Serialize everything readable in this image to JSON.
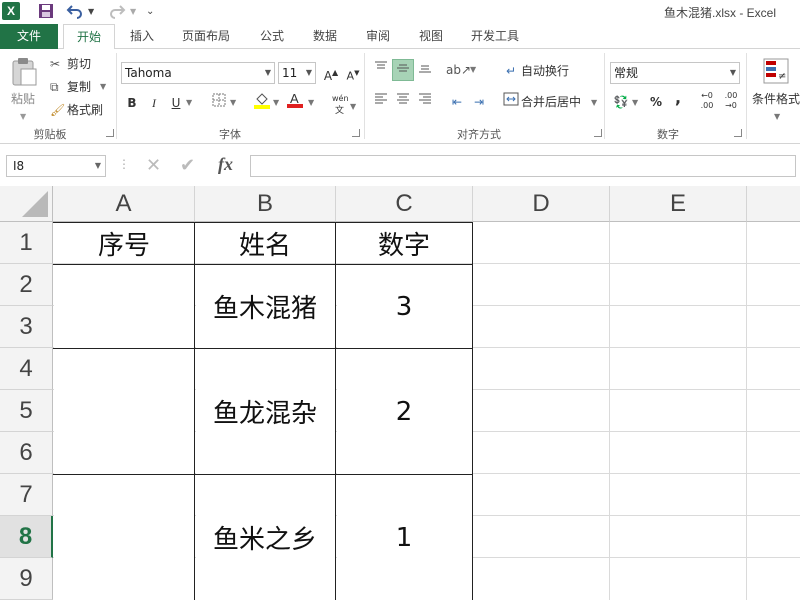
{
  "window": {
    "title": "鱼木混猪.xlsx - Excel",
    "app_logo": "X"
  },
  "quick_access": {
    "save_icon": "save-icon",
    "undo_icon": "undo-icon",
    "redo_icon": "redo-icon"
  },
  "tabs": [
    {
      "label": "文件"
    },
    {
      "label": "开始"
    },
    {
      "label": "插入"
    },
    {
      "label": "页面布局"
    },
    {
      "label": "公式"
    },
    {
      "label": "数据"
    },
    {
      "label": "审阅"
    },
    {
      "label": "视图"
    },
    {
      "label": "开发工具"
    }
  ],
  "ribbon": {
    "clipboard": {
      "paste": "粘贴",
      "cut": "剪切",
      "copy": "复制",
      "format_painter": "格式刷",
      "label": "剪贴板"
    },
    "font": {
      "name": "Tahoma",
      "size": "11",
      "bold": "B",
      "italic": "I",
      "underline": "U",
      "phonetic": "wén",
      "label": "字体"
    },
    "alignment": {
      "wrap_text": "自动换行",
      "merge_center": "合并后居中",
      "label": "对齐方式"
    },
    "number": {
      "format": "常规",
      "percent": "%",
      "comma": ",",
      "label": "数字"
    },
    "styles": {
      "conditional": "条件格式"
    }
  },
  "formula_bar": {
    "name_box": "I8",
    "fx": "fx",
    "value": ""
  },
  "sheet": {
    "columns": [
      "A",
      "B",
      "C",
      "D",
      "E"
    ],
    "rows": [
      "1",
      "2",
      "3",
      "4",
      "5",
      "6",
      "7",
      "8",
      "9"
    ],
    "active_row": "8",
    "headers": {
      "a1": "序号",
      "b1": "姓名",
      "c1": "数字"
    },
    "records": [
      {
        "name": "鱼木混猪",
        "value": "3"
      },
      {
        "name": "鱼龙混杂",
        "value": "2"
      },
      {
        "name": "鱼米之乡",
        "value": "1"
      }
    ]
  },
  "colors": {
    "excel_green": "#217346",
    "ribbon_selected": "#a7d3b6"
  }
}
